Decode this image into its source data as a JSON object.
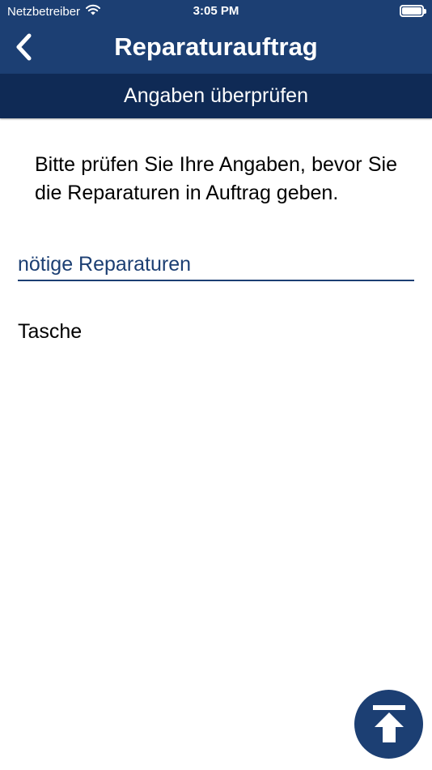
{
  "status_bar": {
    "carrier": "Netzbetreiber",
    "time": "3:05 PM",
    "wifi_icon": "wifi-icon",
    "battery_icon": "battery-icon"
  },
  "nav": {
    "title": "Reparaturauftrag",
    "back_icon": "chevron-left-icon"
  },
  "subheader": {
    "title": "Angaben überprüfen"
  },
  "content": {
    "intro": "Bitte prüfen Sie Ihre Angaben, bevor Sie die Reparaturen in Auftrag geben.",
    "section_title": "nötige Reparaturen",
    "items": [
      "Tasche"
    ]
  },
  "fab": {
    "icon": "scroll-to-top-icon"
  },
  "colors": {
    "header": "#1c3f73",
    "subheader": "#0f2a55",
    "accent": "#1c3f73"
  }
}
